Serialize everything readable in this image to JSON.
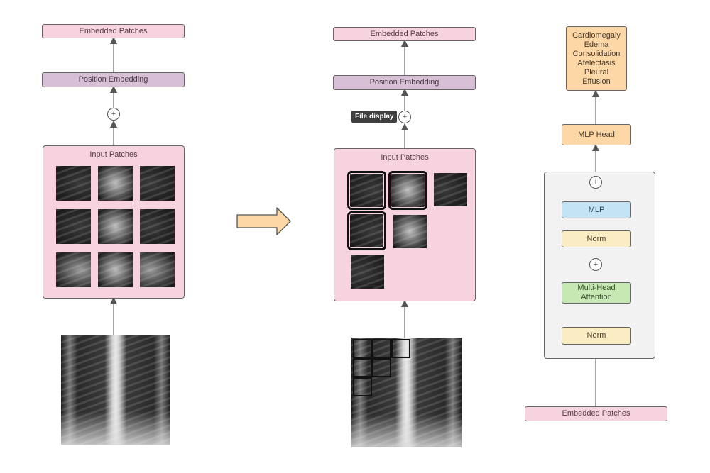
{
  "left_diagram": {
    "embedded_patches": "Embedded Patches",
    "position_embedding": "Position Embedding",
    "plus_symbol": "+",
    "input_patches_title": "Input Patches",
    "patch_count": 9
  },
  "transition_arrow": {
    "icon": "right-arrow"
  },
  "middle_diagram": {
    "embedded_patches": "Embedded Patches",
    "position_embedding": "Position Embedding",
    "plus_symbol": "+",
    "input_patches_title": "Input Patches",
    "tooltip": "File display",
    "patch_count": 6,
    "highlighted_patches": 3
  },
  "right_diagram": {
    "classes": [
      "Cardiomegaly",
      "Edema",
      "Consolidation",
      "Atelectasis",
      "Pleural",
      "Effusion"
    ],
    "mlp_head": "MLP Head",
    "mlp": "MLP",
    "norm_top": "Norm",
    "attention_line1": "Multi-Head",
    "attention_line2": "Attention",
    "norm_bottom": "Norm",
    "embedded_patches": "Embedded Patches",
    "plus_symbol": "+"
  },
  "colors": {
    "pink": "#f7d3df",
    "purple": "#d7bfd6",
    "orange": "#fdd7a6",
    "blue": "#c3e4f5",
    "yellow": "#faedc3",
    "green": "#c6e8b2",
    "encoder_bg": "#f2f2f2",
    "tooltip_bg": "#3f3f3f"
  }
}
